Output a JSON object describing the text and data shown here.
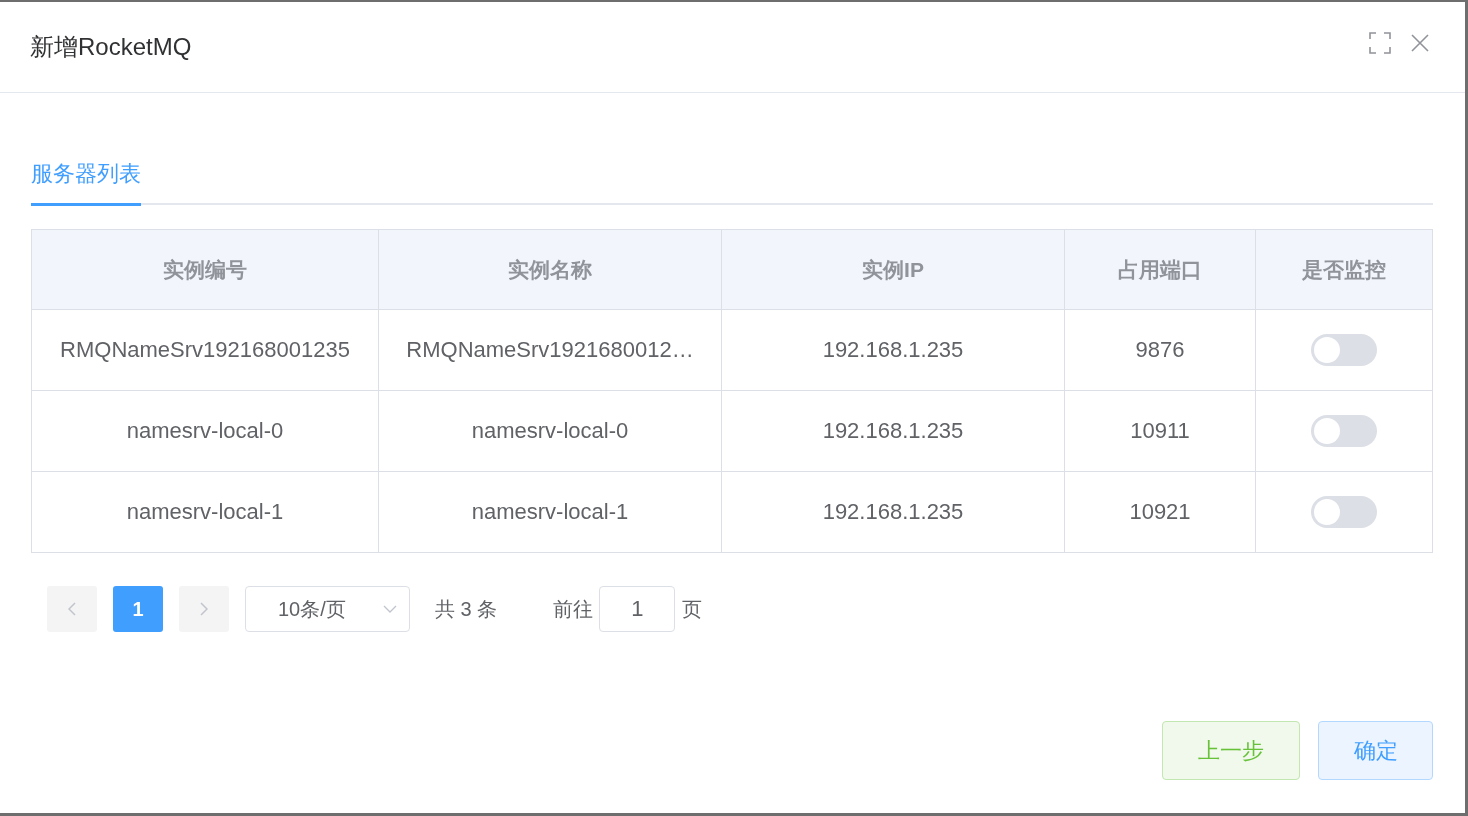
{
  "dialog": {
    "title": "新增RocketMQ"
  },
  "tabs": [
    {
      "label": "服务器列表",
      "selected": true
    }
  ],
  "table": {
    "columns": [
      "实例编号",
      "实例名称",
      "实例IP",
      "占用端口",
      "是否监控"
    ],
    "rows": [
      {
        "id": "RMQNameSrv192168001235",
        "name": "RMQNameSrv1921680012…",
        "ip": "192.168.1.235",
        "port": "9876",
        "monitored": false
      },
      {
        "id": "namesrv-local-0",
        "name": "namesrv-local-0",
        "ip": "192.168.1.235",
        "port": "10911",
        "monitored": false
      },
      {
        "id": "namesrv-local-1",
        "name": "namesrv-local-1",
        "ip": "192.168.1.235",
        "port": "10921",
        "monitored": false
      }
    ]
  },
  "pagination": {
    "pages": [
      {
        "label": "1",
        "selected": true
      }
    ],
    "page_size": "10条/页",
    "total": "共 3 条",
    "goto_label": "前往",
    "goto_value": "1",
    "goto_suffix": "页"
  },
  "buttons": [
    {
      "label": "上一步",
      "kind": "back"
    },
    {
      "label": "确定",
      "kind": "confirm"
    }
  ]
}
